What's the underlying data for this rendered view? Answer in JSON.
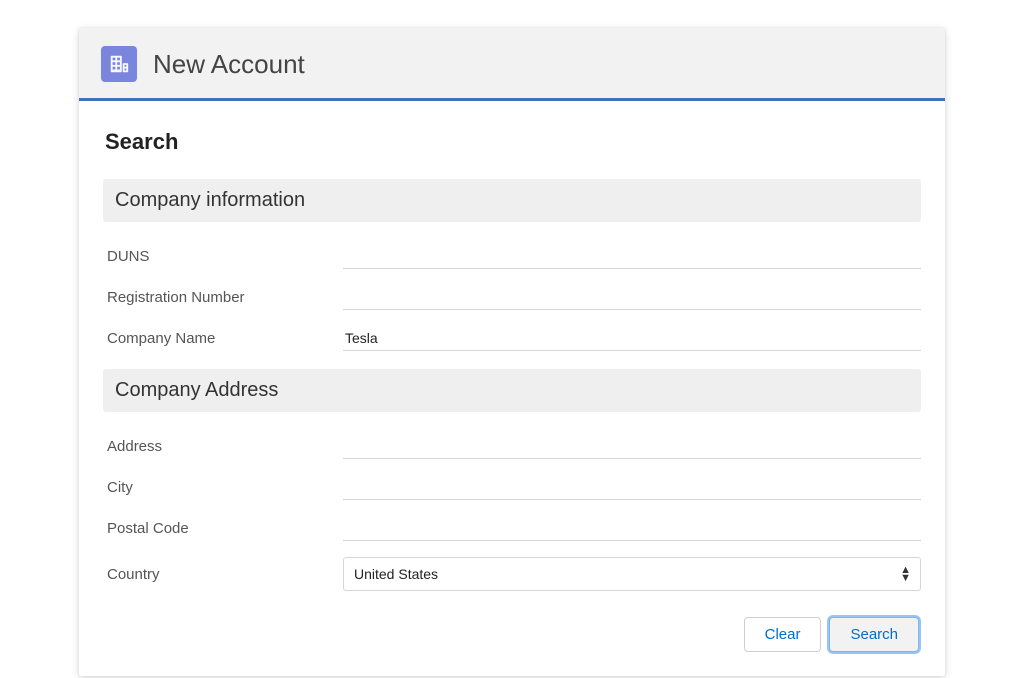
{
  "header": {
    "title": "New Account"
  },
  "search": {
    "title": "Search"
  },
  "sections": {
    "company_info": {
      "title": "Company information",
      "fields": {
        "duns": {
          "label": "DUNS",
          "value": ""
        },
        "reg_number": {
          "label": "Registration Number",
          "value": ""
        },
        "company_name": {
          "label": "Company Name",
          "value": "Tesla"
        }
      }
    },
    "company_address": {
      "title": "Company Address",
      "fields": {
        "address": {
          "label": "Address",
          "value": ""
        },
        "city": {
          "label": "City",
          "value": ""
        },
        "postal_code": {
          "label": "Postal Code",
          "value": ""
        },
        "country": {
          "label": "Country",
          "value": "United States"
        }
      }
    }
  },
  "actions": {
    "clear_label": "Clear",
    "search_label": "Search"
  }
}
